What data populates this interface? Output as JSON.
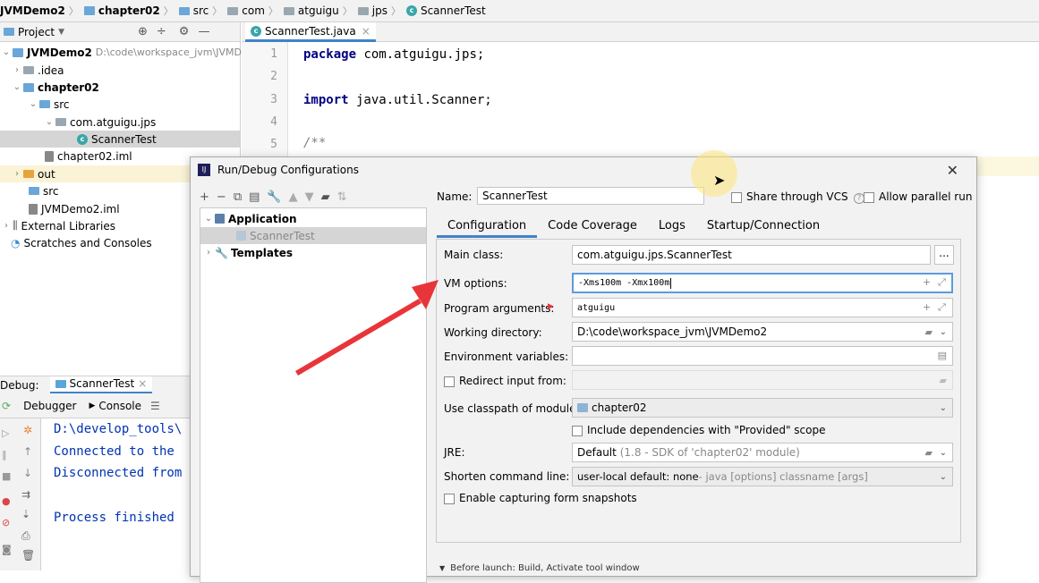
{
  "breadcrumb": [
    "JVMDemo2",
    "chapter02",
    "src",
    "com",
    "atguigu",
    "jps",
    "ScannerTest"
  ],
  "project": {
    "header_label": "Project",
    "tree": [
      {
        "label": "JVMDemo2",
        "path": "D:\\code\\workspace_jvm\\JVMDe"
      },
      {
        "label": ".idea"
      },
      {
        "label": "chapter02"
      },
      {
        "label": "src"
      },
      {
        "label": "com.atguigu.jps"
      },
      {
        "label": "ScannerTest"
      },
      {
        "label": "chapter02.iml"
      },
      {
        "label": "out"
      },
      {
        "label": "src"
      },
      {
        "label": "JVMDemo2.iml"
      },
      {
        "label": "External Libraries"
      },
      {
        "label": "Scratches and Consoles"
      }
    ]
  },
  "editor": {
    "tab_label": "ScannerTest.java",
    "lines": [
      {
        "no": "1",
        "kw": "package",
        "rest": " com.atguigu.jps;"
      },
      {
        "no": "2",
        "kw": "",
        "rest": ""
      },
      {
        "no": "3",
        "kw": "import",
        "rest": " java.util.Scanner;"
      },
      {
        "no": "4",
        "kw": "",
        "rest": ""
      },
      {
        "no": "5",
        "kw": "",
        "rest": "/**"
      }
    ]
  },
  "debug": {
    "label": "Debug:",
    "tab": "ScannerTest",
    "debugger_tab": "Debugger",
    "console_tab": "Console",
    "console_lines": [
      "D:\\develop_tools\\",
      "Connected to the ",
      "Disconnected from",
      "",
      "Process finished "
    ]
  },
  "dialog": {
    "title": "Run/Debug Configurations",
    "tree": {
      "application": "Application",
      "scanner_test": "ScannerTest",
      "templates": "Templates"
    },
    "name_label": "Name:",
    "name_value": "ScannerTest",
    "share_label": "Share through VCS",
    "allow_parallel_label": "Allow parallel run",
    "tabs": [
      "Configuration",
      "Code Coverage",
      "Logs",
      "Startup/Connection"
    ],
    "fields": {
      "main_class_label": "Main class:",
      "main_class_value": "com.atguigu.jps.ScannerTest",
      "vm_options_label": "VM options:",
      "vm_options_value": "-Xms100m -Xmx100m",
      "program_args_label": "Program arguments:",
      "program_args_value": "atguigu",
      "working_dir_label": "Working directory:",
      "working_dir_value": "D:\\code\\workspace_jvm\\JVMDemo2",
      "env_label": "Environment variables:",
      "env_value": "",
      "redirect_label": "Redirect input from:",
      "classpath_label": "Use classpath of module:",
      "classpath_value": "chapter02",
      "include_deps_label": "Include dependencies with \"Provided\" scope",
      "jre_label": "JRE:",
      "jre_value": "Default",
      "jre_hint": "(1.8 - SDK of 'chapter02' module)",
      "shorten_label": "Shorten command line:",
      "shorten_value": "user-local default: none",
      "shorten_hint": " - java [options] classname [args]",
      "snapshots_label": "Enable capturing form snapshots"
    },
    "before_launch": "Before launch: Build, Activate tool window"
  },
  "colors": {
    "accent": "#4083c9",
    "arrow": "#e8353a",
    "keyword": "#000080"
  }
}
